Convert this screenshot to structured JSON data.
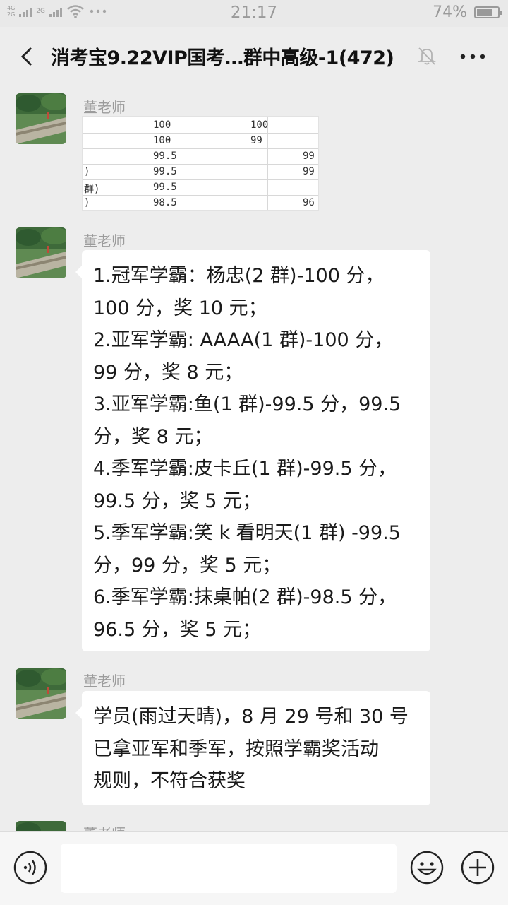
{
  "status_bar": {
    "net_top": "4G",
    "net_bottom": "2G",
    "net2": "2G",
    "time": "21:17",
    "battery_text": "74%",
    "battery_level": 0.74
  },
  "header": {
    "title": "消考宝9.22VIP国考…群中高级-1(472)"
  },
  "messages": [
    {
      "sender": "董老师",
      "type": "image",
      "image_rows": [
        {
          "a": "",
          "b": "100",
          "c": "100",
          "d": ""
        },
        {
          "a": "",
          "b": "100",
          "c": "99",
          "d": ""
        },
        {
          "a": "",
          "b": "99.5",
          "c": "",
          "d": "99"
        },
        {
          "a": ")",
          "b": "99.5",
          "c": "",
          "d": "99"
        },
        {
          "a": "群)",
          "b": "99.5",
          "c": "",
          "d": ""
        },
        {
          "a": ")",
          "b": "98.5",
          "c": "",
          "d": "96"
        }
      ]
    },
    {
      "sender": "董老师",
      "type": "text",
      "lines": [
        "1.冠军学霸：杨忠(2 群)-100 分，",
        "100 分，奖 10 元；",
        "2.亚军学霸: AAAA(1 群)-100 分，",
        "99 分，奖 8 元；",
        "3.亚军学霸:鱼(1 群)-99.5 分，99.5",
        "分，奖 8 元；",
        "4.季军学霸:皮卡丘(1 群)-99.5 分，",
        "99.5 分，奖 5 元；",
        "5.季军学霸:笑 k 看明天(1 群) -99.5",
        "分，99 分，奖 5 元；",
        "6.季军学霸:抹桌帕(2 群)-98.5 分，",
        "96.5 分，奖 5 元；"
      ]
    },
    {
      "sender": "董老师",
      "type": "text",
      "lines": [
        "学员(雨过天晴)，8 月 29 号和 30 号",
        "已拿亚军和季军，按照学霸奖活动",
        "规则，不符合获奖"
      ]
    },
    {
      "sender": "董老师",
      "type": "partial"
    }
  ],
  "icons": {
    "back": "chevron-left-icon",
    "bell": "mute-bell-icon",
    "more": "more-dots-icon",
    "voice": "voice-icon",
    "emoji": "emoji-icon",
    "plus": "plus-icon"
  }
}
